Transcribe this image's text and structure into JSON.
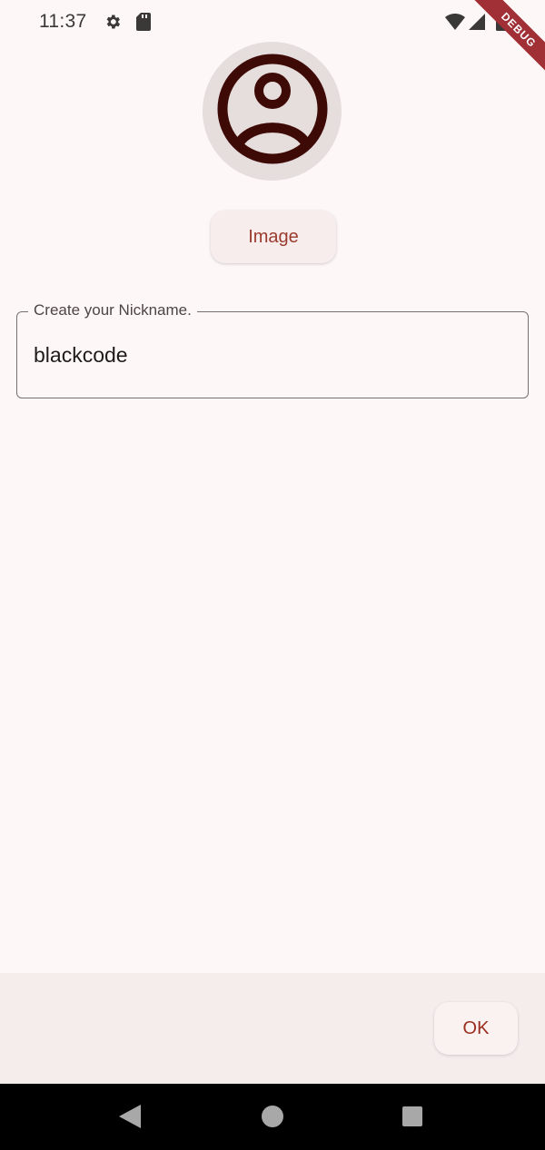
{
  "status_bar": {
    "time": "11:37",
    "icons": [
      "gear-icon",
      "sd-card-icon",
      "wifi-icon",
      "signal-icon",
      "battery-icon"
    ]
  },
  "debug_banner": {
    "label": "DEBUG"
  },
  "profile": {
    "avatar_icon": "account-circle-icon",
    "image_button_label": "Image"
  },
  "nickname": {
    "label": "Create your Nickname.",
    "value": "blackcode"
  },
  "actions": {
    "ok_label": "OK"
  },
  "nav": {
    "icons": [
      "back-icon",
      "home-icon",
      "recents-icon"
    ]
  },
  "colors": {
    "background": "#fdf7f8",
    "accent": "#9a3b2e",
    "avatar_bg": "#e6dddd",
    "avatar_icon": "#3d0a06",
    "debug_banner": "#a02f36"
  }
}
